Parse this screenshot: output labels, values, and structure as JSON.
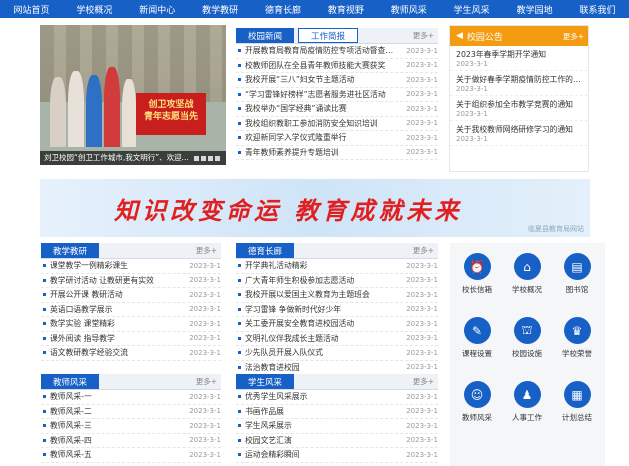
{
  "nav": [
    "网站首页",
    "学校概况",
    "新闻中心",
    "教学教研",
    "德育长廊",
    "教育视野",
    "教师风采",
    "学生风采",
    "教学园地",
    "联系我们"
  ],
  "slider": {
    "caption": "刘卫校园“创卫工作城市,我文明行”、欢迎...",
    "banner_text": "创卫攻坚战\n青年志愿当先"
  },
  "news": {
    "tabs": [
      "校园新闻",
      "工作简报"
    ],
    "more": "更多+",
    "items": [
      {
        "t": "开展教育局教育局疫情防控专项活动督查工作",
        "d": "2023-3-1"
      },
      {
        "t": "校教师团队在全县青年教师技能大赛获奖",
        "d": "2023-3-1"
      },
      {
        "t": "我校开展“三八”妇女节主题活动",
        "d": "2023-3-1"
      },
      {
        "t": "“学习雷锋好榜样”志愿者服务进社区活动",
        "d": "2023-3-1"
      },
      {
        "t": "我校举办“国学经典”诵读比赛",
        "d": "2023-3-1"
      },
      {
        "t": "我校组织教职工参加消防安全知识培训",
        "d": "2023-3-1"
      },
      {
        "t": "欢迎新同学入学仪式隆重举行",
        "d": "2023-3-1"
      },
      {
        "t": "青年教师素养提升专题培训",
        "d": "2023-3-1"
      }
    ]
  },
  "notice": {
    "title": "校园公告",
    "more": "更多+",
    "items": [
      {
        "t": "2023年春季学期开学通知",
        "d": "2023-3-1"
      },
      {
        "t": "关于做好春季学期疫情防控工作的通知",
        "d": "2023-3-1"
      },
      {
        "t": "关于组织参加全市教学竞赛的通知",
        "d": "2023-3-1"
      },
      {
        "t": "关于我校教师网络研修学习的通知",
        "d": "2023-3-1"
      }
    ]
  },
  "banner": {
    "slogan": "知识改变命运  教育成就未来",
    "watermark": "临夏县教育局网站"
  },
  "teaching": {
    "title": "教学教研",
    "more": "更多+",
    "items": [
      {
        "t": "课堂教学一例精彩课生",
        "d": "2023-3-1"
      },
      {
        "t": "教学研讨活动 让教研更有实效",
        "d": "2023-3-1"
      },
      {
        "t": "开展公开课 教研活动",
        "d": "2023-3-1"
      },
      {
        "t": "英语口语教学展示",
        "d": "2023-3-1"
      },
      {
        "t": "数学实验 课堂精彩",
        "d": "2023-3-1"
      },
      {
        "t": "课外阅读 指导教学",
        "d": "2023-3-1"
      },
      {
        "t": "语文教研教学经验交流",
        "d": "2023-3-1"
      }
    ]
  },
  "moral": {
    "title": "德育长廊",
    "more": "更多+",
    "items": [
      {
        "t": "开学典礼活动精彩",
        "d": "2023-3-1"
      },
      {
        "t": "广大青年师生积极参加志愿活动",
        "d": "2023-3-1"
      },
      {
        "t": "我校开展以爱国主义教育为主题班会",
        "d": "2023-3-1"
      },
      {
        "t": "学习雷锋 争做新时代好少年",
        "d": "2023-3-1"
      },
      {
        "t": "关工委开展安全教育进校园活动",
        "d": "2023-3-1"
      },
      {
        "t": "文明礼仪伴我成长主题活动",
        "d": "2023-3-1"
      },
      {
        "t": "少先队员开展入队仪式",
        "d": "2023-3-1"
      },
      {
        "t": "法治教育进校园",
        "d": "2023-3-1"
      }
    ]
  },
  "teachers": {
    "title": "教师风采",
    "more": "更多+",
    "items": [
      {
        "t": "教师风采-一",
        "d": "2023-3-1"
      },
      {
        "t": "教师风采-二",
        "d": "2023-3-1"
      },
      {
        "t": "教师风采-三",
        "d": "2023-3-1"
      },
      {
        "t": "教师风采-四",
        "d": "2023-3-1"
      },
      {
        "t": "教师风采-五",
        "d": "2023-3-1"
      }
    ]
  },
  "students": {
    "title": "学生风采",
    "more": "更多+",
    "items": [
      {
        "t": "优秀学生风采展示",
        "d": "2023-3-1"
      },
      {
        "t": "书画作品展",
        "d": "2023-3-1"
      },
      {
        "t": "学生风采展示",
        "d": "2023-3-1"
      },
      {
        "t": "校园文艺汇演",
        "d": "2023-3-1"
      },
      {
        "t": "运动会精彩瞬间",
        "d": "2023-3-1"
      }
    ]
  },
  "icons": [
    {
      "l": "校长信箱",
      "icon": "clock-icon",
      "g": "⏰"
    },
    {
      "l": "学校概况",
      "icon": "school-icon",
      "g": "⌂"
    },
    {
      "l": "图书馆",
      "icon": "book-icon",
      "g": "▤"
    },
    {
      "l": "课程设置",
      "icon": "document-icon",
      "g": "✎"
    },
    {
      "l": "校园设施",
      "icon": "building-icon",
      "g": "⛫"
    },
    {
      "l": "学校荣誉",
      "icon": "award-icon",
      "g": "♛"
    },
    {
      "l": "教师风采",
      "icon": "teacher-icon",
      "g": "☺"
    },
    {
      "l": "人事工作",
      "icon": "people-icon",
      "g": "♟"
    },
    {
      "l": "计划总结",
      "icon": "chart-icon",
      "g": "▦"
    }
  ]
}
